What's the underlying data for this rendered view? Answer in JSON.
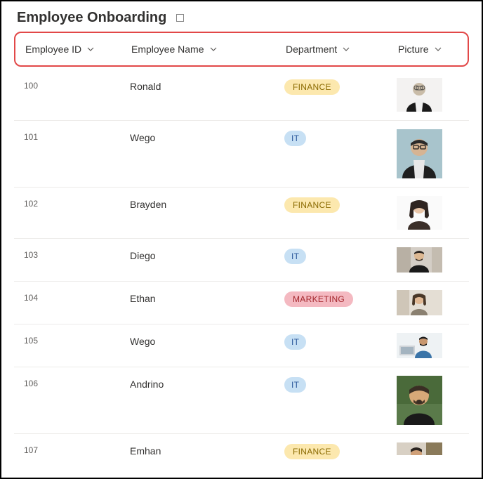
{
  "title": "Employee Onboarding",
  "columns": {
    "id": "Employee ID",
    "name": "Employee Name",
    "dept": "Department",
    "pic": "Picture"
  },
  "departments": {
    "finance": "FINANCE",
    "it": "IT",
    "marketing": "MARKETING"
  },
  "colors": {
    "highlight_border": "#e24848",
    "pill_finance_bg": "#fce8ae",
    "pill_finance_fg": "#8a6a00",
    "pill_it_bg": "#c7e0f4",
    "pill_it_fg": "#2b579a",
    "pill_marketing_bg": "#f4b9c1",
    "pill_marketing_fg": "#a4262c"
  },
  "rows": [
    {
      "id": "100",
      "name": "Ronald",
      "dept": "finance"
    },
    {
      "id": "101",
      "name": "Wego",
      "dept": "it"
    },
    {
      "id": "102",
      "name": "Brayden",
      "dept": "finance"
    },
    {
      "id": "103",
      "name": "Diego",
      "dept": "it"
    },
    {
      "id": "104",
      "name": "Ethan",
      "dept": "marketing"
    },
    {
      "id": "105",
      "name": "Wego",
      "dept": "it"
    },
    {
      "id": "106",
      "name": "Andrino",
      "dept": "it"
    },
    {
      "id": "107",
      "name": "Emhan",
      "dept": "finance"
    }
  ]
}
